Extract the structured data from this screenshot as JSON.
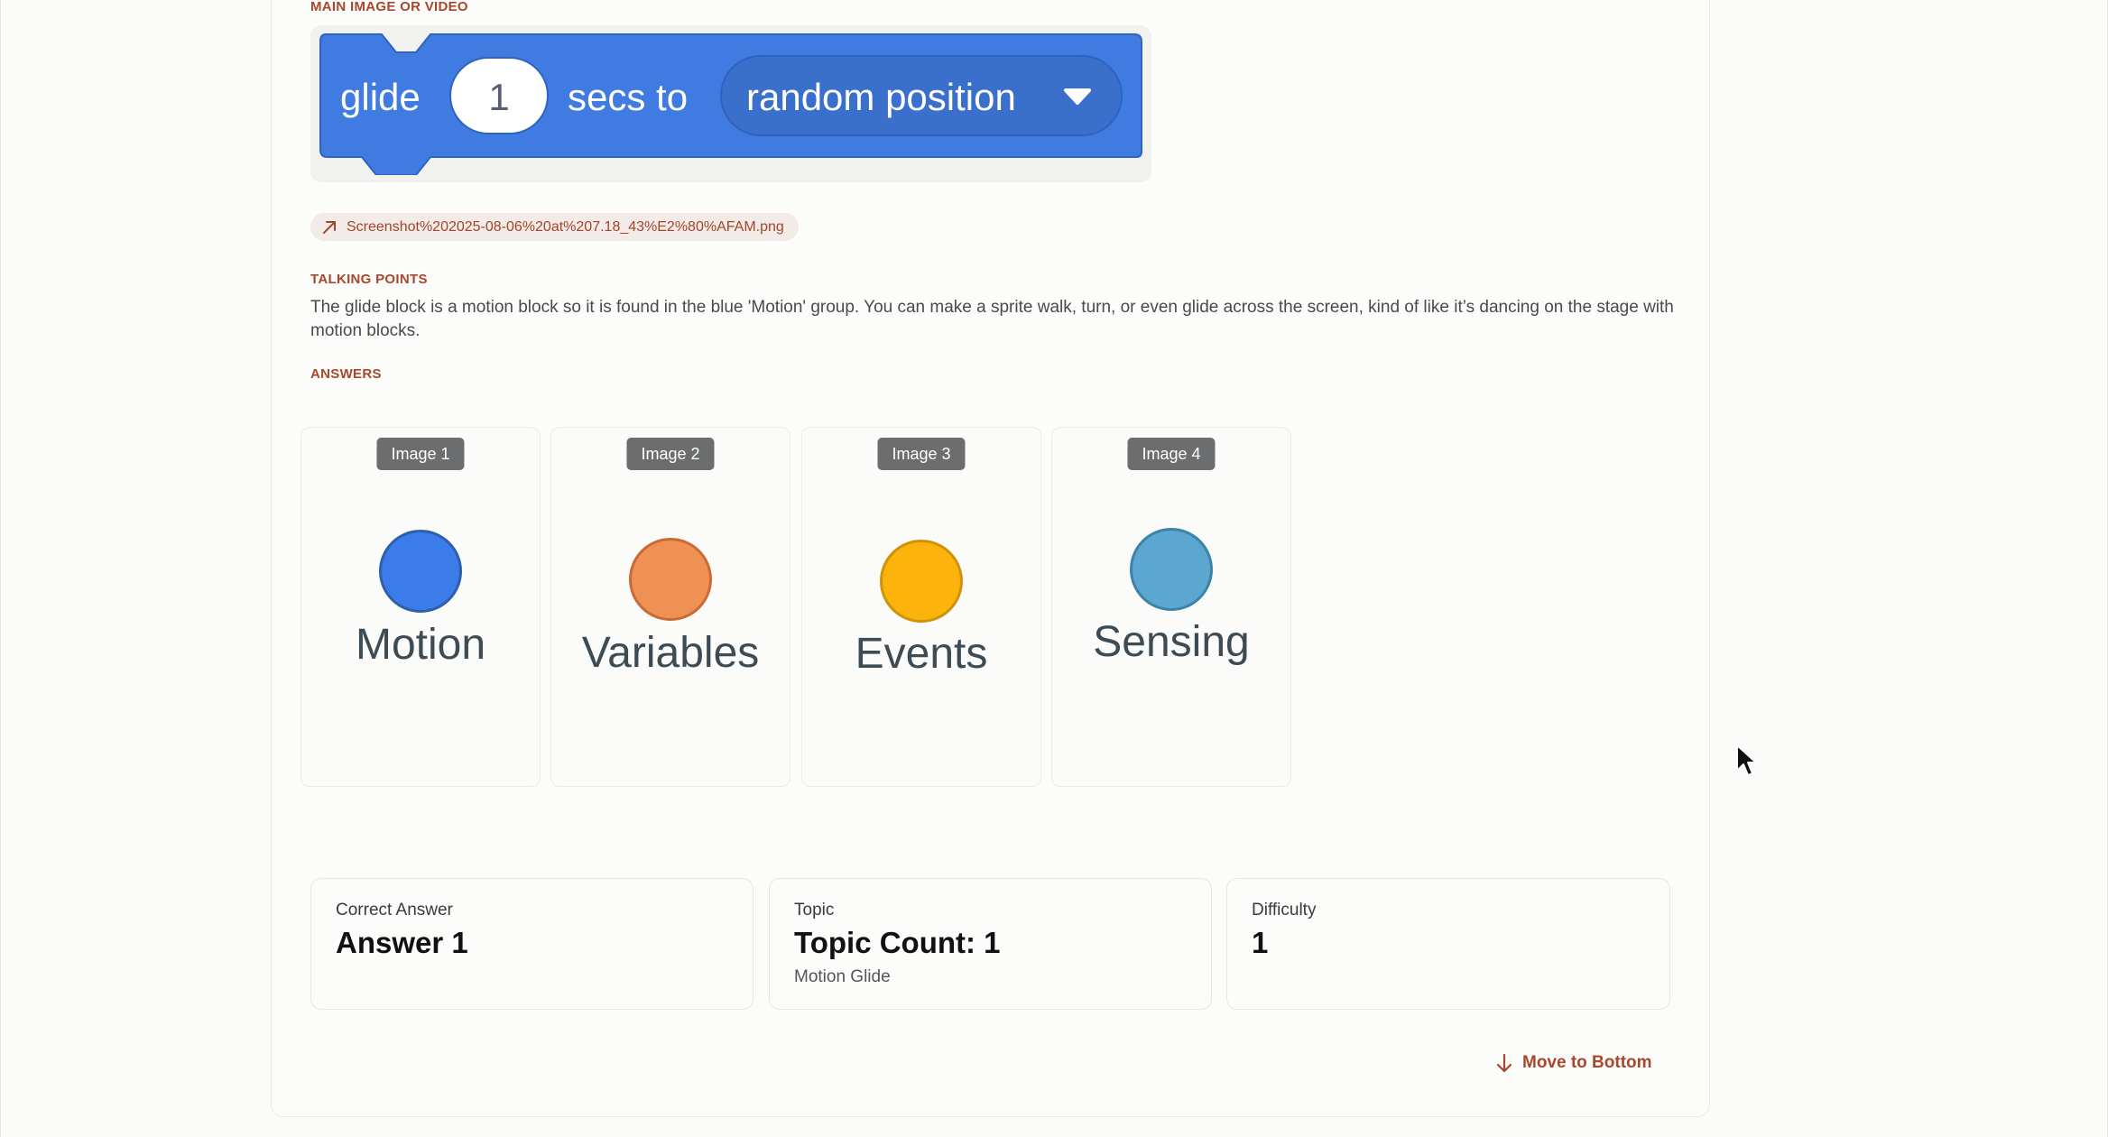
{
  "sections": {
    "main_media_label": "MAIN IMAGE OR VIDEO",
    "talking_points_label": "TALKING POINTS",
    "answers_label": "ANSWERS"
  },
  "block": {
    "verb": "glide",
    "seconds": "1",
    "connector": "secs to",
    "target": "random position",
    "color": "#3f7be0"
  },
  "attachment": {
    "filename": "Screenshot%202025-08-06%20at%207.18_43%E2%80%AFAM.png",
    "icon": "external-link-arrow-icon"
  },
  "talking_points": "The glide block is a motion block so it is found in the blue 'Motion' group. You can make a sprite walk, turn, or even glide across the screen, kind of like it’s dancing on the stage with motion blocks.",
  "answers": [
    {
      "badge": "Image 1",
      "category": "Motion",
      "fill": "#3b7bea",
      "stroke": "#2f5fa8"
    },
    {
      "badge": "Image 2",
      "category": "Variables",
      "fill": "#ef9155",
      "stroke": "#c96a36"
    },
    {
      "badge": "Image 3",
      "category": "Events",
      "fill": "#fcb30b",
      "stroke": "#cf920c"
    },
    {
      "badge": "Image 4",
      "category": "Sensing",
      "fill": "#5ba7cf",
      "stroke": "#3b83a8"
    }
  ],
  "stats": {
    "correct_answer": {
      "label": "Correct Answer",
      "value": "Answer 1"
    },
    "topic": {
      "label": "Topic",
      "value": "Topic Count: 1",
      "sub": "Motion Glide"
    },
    "difficulty": {
      "label": "Difficulty",
      "value": "1"
    }
  },
  "actions": {
    "move_to_bottom": "Move to Bottom"
  },
  "colors": {
    "accent": "#a8472c",
    "badge_bg": "#6b6d6e"
  }
}
